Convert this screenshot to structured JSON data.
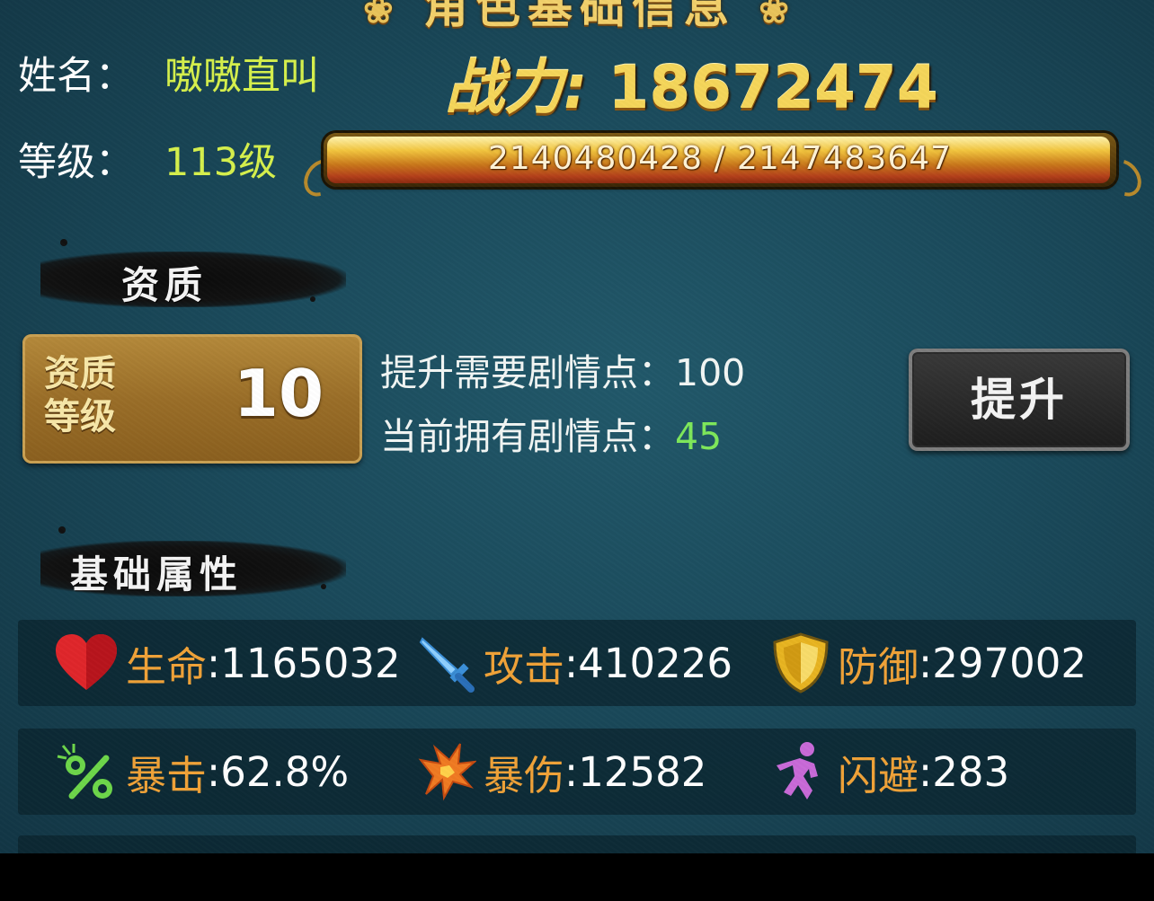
{
  "window": {
    "title": "角色基础信息"
  },
  "player": {
    "name_label": "姓名：",
    "name": "嗷嗷直叫",
    "level_label": "等级：",
    "level": "113级",
    "power_label": "战力:",
    "power": "18672474",
    "xp_text": "2140480428 / 2147483647",
    "xp_progress": 0.9967
  },
  "aptitude": {
    "section_title": "资质",
    "card_label_line1": "资质",
    "card_label_line2": "等级",
    "card_value": "10",
    "req_label": "提升需要剧情点：",
    "req_value": "100",
    "own_label": "当前拥有剧情点：",
    "own_value": "45",
    "upgrade_button": "提升"
  },
  "attributes": {
    "section_title": "基础属性",
    "rows": [
      [
        {
          "icon": "heart-icon",
          "name": "生命",
          "sep": ":",
          "value": "1165032"
        },
        {
          "icon": "sword-icon",
          "name": "攻击",
          "sep": ":",
          "value": "410226"
        },
        {
          "icon": "shield-icon",
          "name": "防御",
          "sep": ":",
          "value": "297002"
        }
      ],
      [
        {
          "icon": "percent-icon",
          "name": "暴击",
          "sep": ":",
          "value": "62.8%"
        },
        {
          "icon": "burst-icon",
          "name": "暴伤",
          "sep": ":",
          "value": "12582"
        },
        {
          "icon": "dodge-icon",
          "name": "闪避",
          "sep": ":",
          "value": "283"
        }
      ]
    ]
  },
  "colors": {
    "background": "#1a4a5b",
    "value_green": "#d6f04c",
    "attr_name": "#f0a238",
    "owned_points": "#7ee85a",
    "power_gold": "#f5d65a"
  }
}
